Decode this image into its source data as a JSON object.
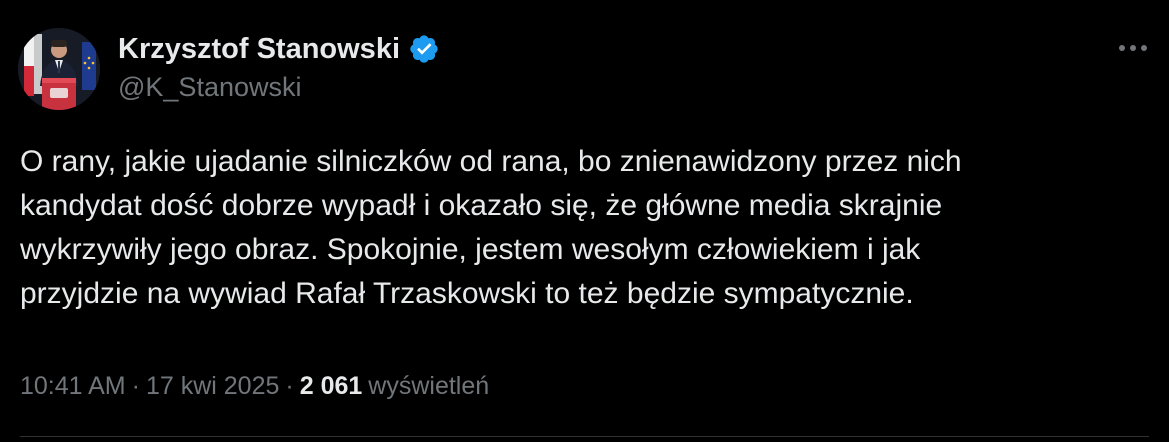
{
  "author": {
    "name": "Krzysztof Stanowski",
    "handle": "@K_Stanowski",
    "verified": true
  },
  "tweet": {
    "lines": [
      "O rany, jakie ujadanie silniczków od rana, bo znienawidzony przez nich",
      "kandydat dość dobrze wypadł i okazało się, że główne media skrajnie",
      "wykrzywiły jego obraz. Spokojnie, jestem wesołym człowiekiem i jak",
      "przyjdzie na wywiad Rafał Trzaskowski to też będzie sympatycznie."
    ]
  },
  "meta": {
    "time": "10:41 AM",
    "separator": "·",
    "date": "17 kwi 2025",
    "views_count": "2 061",
    "views_label": "wyświetleń"
  },
  "colors": {
    "background": "#000000",
    "primary_text": "#e7e9ea",
    "secondary_text": "#71767b",
    "verified_badge": "#1d9bf0",
    "divider": "#2f3336"
  },
  "icons": {
    "verified": "verified-badge-icon",
    "more": "more-horizontal-icon"
  }
}
